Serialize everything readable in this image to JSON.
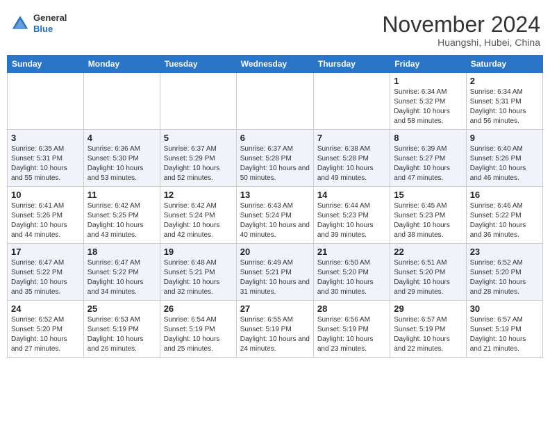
{
  "header": {
    "logo_line1": "General",
    "logo_line2": "Blue",
    "month": "November 2024",
    "location": "Huangshi, Hubei, China"
  },
  "weekdays": [
    "Sunday",
    "Monday",
    "Tuesday",
    "Wednesday",
    "Thursday",
    "Friday",
    "Saturday"
  ],
  "weeks": [
    [
      {
        "day": "",
        "info": ""
      },
      {
        "day": "",
        "info": ""
      },
      {
        "day": "",
        "info": ""
      },
      {
        "day": "",
        "info": ""
      },
      {
        "day": "",
        "info": ""
      },
      {
        "day": "1",
        "info": "Sunrise: 6:34 AM\nSunset: 5:32 PM\nDaylight: 10 hours and 58 minutes."
      },
      {
        "day": "2",
        "info": "Sunrise: 6:34 AM\nSunset: 5:31 PM\nDaylight: 10 hours and 56 minutes."
      }
    ],
    [
      {
        "day": "3",
        "info": "Sunrise: 6:35 AM\nSunset: 5:31 PM\nDaylight: 10 hours and 55 minutes."
      },
      {
        "day": "4",
        "info": "Sunrise: 6:36 AM\nSunset: 5:30 PM\nDaylight: 10 hours and 53 minutes."
      },
      {
        "day": "5",
        "info": "Sunrise: 6:37 AM\nSunset: 5:29 PM\nDaylight: 10 hours and 52 minutes."
      },
      {
        "day": "6",
        "info": "Sunrise: 6:37 AM\nSunset: 5:28 PM\nDaylight: 10 hours and 50 minutes."
      },
      {
        "day": "7",
        "info": "Sunrise: 6:38 AM\nSunset: 5:28 PM\nDaylight: 10 hours and 49 minutes."
      },
      {
        "day": "8",
        "info": "Sunrise: 6:39 AM\nSunset: 5:27 PM\nDaylight: 10 hours and 47 minutes."
      },
      {
        "day": "9",
        "info": "Sunrise: 6:40 AM\nSunset: 5:26 PM\nDaylight: 10 hours and 46 minutes."
      }
    ],
    [
      {
        "day": "10",
        "info": "Sunrise: 6:41 AM\nSunset: 5:26 PM\nDaylight: 10 hours and 44 minutes."
      },
      {
        "day": "11",
        "info": "Sunrise: 6:42 AM\nSunset: 5:25 PM\nDaylight: 10 hours and 43 minutes."
      },
      {
        "day": "12",
        "info": "Sunrise: 6:42 AM\nSunset: 5:24 PM\nDaylight: 10 hours and 42 minutes."
      },
      {
        "day": "13",
        "info": "Sunrise: 6:43 AM\nSunset: 5:24 PM\nDaylight: 10 hours and 40 minutes."
      },
      {
        "day": "14",
        "info": "Sunrise: 6:44 AM\nSunset: 5:23 PM\nDaylight: 10 hours and 39 minutes."
      },
      {
        "day": "15",
        "info": "Sunrise: 6:45 AM\nSunset: 5:23 PM\nDaylight: 10 hours and 38 minutes."
      },
      {
        "day": "16",
        "info": "Sunrise: 6:46 AM\nSunset: 5:22 PM\nDaylight: 10 hours and 36 minutes."
      }
    ],
    [
      {
        "day": "17",
        "info": "Sunrise: 6:47 AM\nSunset: 5:22 PM\nDaylight: 10 hours and 35 minutes."
      },
      {
        "day": "18",
        "info": "Sunrise: 6:47 AM\nSunset: 5:22 PM\nDaylight: 10 hours and 34 minutes."
      },
      {
        "day": "19",
        "info": "Sunrise: 6:48 AM\nSunset: 5:21 PM\nDaylight: 10 hours and 32 minutes."
      },
      {
        "day": "20",
        "info": "Sunrise: 6:49 AM\nSunset: 5:21 PM\nDaylight: 10 hours and 31 minutes."
      },
      {
        "day": "21",
        "info": "Sunrise: 6:50 AM\nSunset: 5:20 PM\nDaylight: 10 hours and 30 minutes."
      },
      {
        "day": "22",
        "info": "Sunrise: 6:51 AM\nSunset: 5:20 PM\nDaylight: 10 hours and 29 minutes."
      },
      {
        "day": "23",
        "info": "Sunrise: 6:52 AM\nSunset: 5:20 PM\nDaylight: 10 hours and 28 minutes."
      }
    ],
    [
      {
        "day": "24",
        "info": "Sunrise: 6:52 AM\nSunset: 5:20 PM\nDaylight: 10 hours and 27 minutes."
      },
      {
        "day": "25",
        "info": "Sunrise: 6:53 AM\nSunset: 5:19 PM\nDaylight: 10 hours and 26 minutes."
      },
      {
        "day": "26",
        "info": "Sunrise: 6:54 AM\nSunset: 5:19 PM\nDaylight: 10 hours and 25 minutes."
      },
      {
        "day": "27",
        "info": "Sunrise: 6:55 AM\nSunset: 5:19 PM\nDaylight: 10 hours and 24 minutes."
      },
      {
        "day": "28",
        "info": "Sunrise: 6:56 AM\nSunset: 5:19 PM\nDaylight: 10 hours and 23 minutes."
      },
      {
        "day": "29",
        "info": "Sunrise: 6:57 AM\nSunset: 5:19 PM\nDaylight: 10 hours and 22 minutes."
      },
      {
        "day": "30",
        "info": "Sunrise: 6:57 AM\nSunset: 5:19 PM\nDaylight: 10 hours and 21 minutes."
      }
    ]
  ]
}
